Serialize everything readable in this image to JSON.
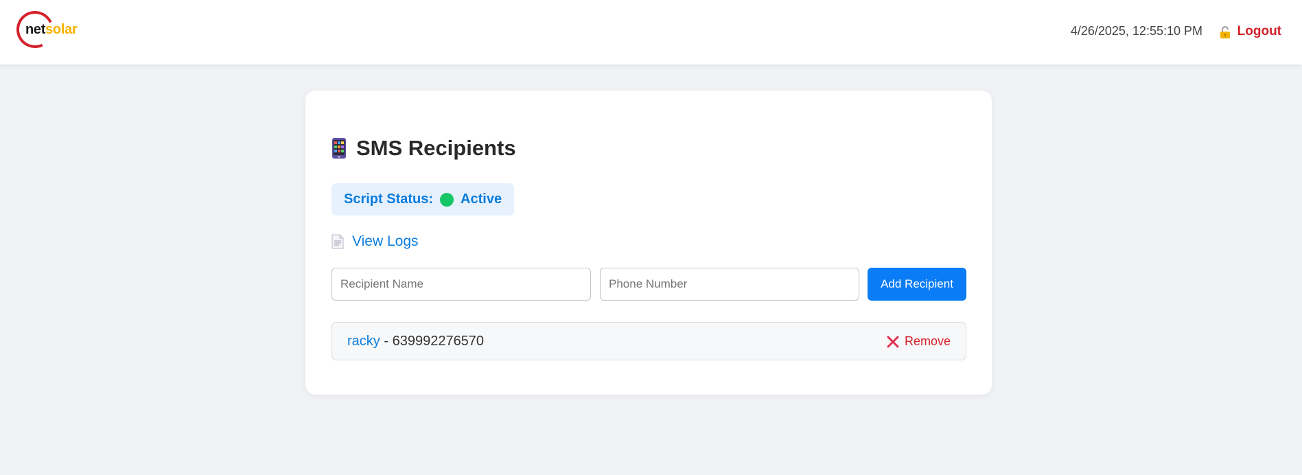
{
  "header": {
    "logo": {
      "net": "net",
      "solar": "solar"
    },
    "datetime": "4/26/2025, 12:55:10 PM",
    "logout_label": "Logout"
  },
  "card": {
    "title": "SMS Recipients",
    "status": {
      "label": "Script Status:",
      "value": "Active",
      "color": "#15c667"
    },
    "logs_label": "View Logs",
    "inputs": {
      "name_placeholder": "Recipient Name",
      "name_value": "",
      "phone_placeholder": "Phone Number",
      "phone_value": ""
    },
    "add_button_label": "Add Recipient",
    "recipients": [
      {
        "name": "racky",
        "separator": " - ",
        "phone": "639992276570",
        "remove_label": "Remove"
      }
    ]
  },
  "icons": {
    "logo": "netsolar-logo",
    "logout": "lock-icon",
    "title": "mobile-phone-icon",
    "status": "status-dot-icon",
    "logs": "document-icon",
    "remove": "close-icon"
  },
  "colors": {
    "accent": "#0a7cf5",
    "link": "#0a7cdd",
    "danger": "#d4202a",
    "brand_yellow": "#f5b300",
    "background": "#f0f2f5"
  }
}
